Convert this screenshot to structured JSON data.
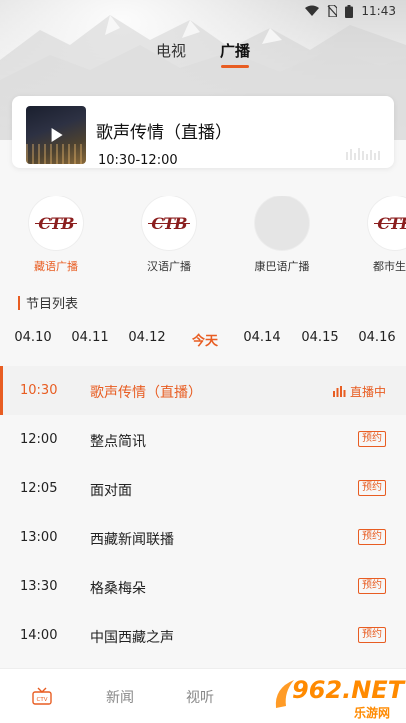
{
  "status_bar": {
    "time": "11:43"
  },
  "top_tabs": [
    {
      "label": "电视",
      "active": false
    },
    {
      "label": "广播",
      "active": true
    }
  ],
  "now_playing": {
    "title": "歌声传情（直播）",
    "time_range": "10:30-12:00"
  },
  "stations": [
    {
      "name": "藏语广播",
      "logo_text": "CTB",
      "active": true
    },
    {
      "name": "汉语广播",
      "logo_text": "CTB",
      "active": false
    },
    {
      "name": "康巴语广播",
      "logo_text": "",
      "active": false
    },
    {
      "name": "都市生活",
      "logo_text": "CTB",
      "active": false
    }
  ],
  "schedule": {
    "section_title": "节目列表",
    "dates": [
      "04.10",
      "04.11",
      "04.12",
      "今天",
      "04.14",
      "04.15",
      "04.16"
    ],
    "active_date": "今天",
    "programs": [
      {
        "time": "10:30",
        "title": "歌声传情（直播）",
        "status": "直播中",
        "live": true
      },
      {
        "time": "12:00",
        "title": "整点简讯",
        "status": "预约",
        "live": false
      },
      {
        "time": "12:05",
        "title": "面对面",
        "status": "预约",
        "live": false
      },
      {
        "time": "13:00",
        "title": "西藏新闻联播",
        "status": "预约",
        "live": false
      },
      {
        "time": "13:30",
        "title": "格桑梅朵",
        "status": "预约",
        "live": false
      },
      {
        "time": "14:00",
        "title": "中国西藏之声",
        "status": "预约",
        "live": false
      }
    ]
  },
  "bottom_nav": {
    "tv_icon_text": "CTV",
    "items": [
      "新闻",
      "视听"
    ]
  },
  "watermark": {
    "text": "962.NET",
    "sub": "乐游网"
  },
  "colors": {
    "accent": "#e85d22",
    "live_row_bg": "#f2f2f2"
  }
}
